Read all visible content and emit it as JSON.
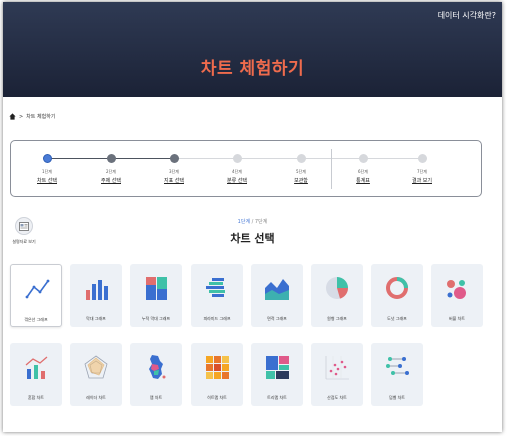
{
  "header": {
    "link_label": "데이터 시각화란?",
    "title": "차트 체험하기"
  },
  "breadcrumb": {
    "current": "차트 체험하기"
  },
  "stepper": {
    "steps": [
      {
        "num": "1단계",
        "label": "차트 선택",
        "state": "active"
      },
      {
        "num": "2단계",
        "label": "주제 선택",
        "state": "done"
      },
      {
        "num": "3단계",
        "label": "지표 선택",
        "state": "done"
      },
      {
        "num": "4단계",
        "label": "분류 선택",
        "state": "todo"
      },
      {
        "num": "5단계",
        "label": "보관함",
        "state": "todo"
      },
      {
        "num": "6단계",
        "label": "통계표",
        "state": "todo"
      },
      {
        "num": "7단계",
        "label": "결과 보기",
        "state": "todo"
      }
    ]
  },
  "guide": {
    "label": "설명자료 보기"
  },
  "page_indicator": {
    "current": "1단계",
    "total": " / 7단계"
  },
  "section_title": "차트 선택",
  "charts": [
    {
      "label": "꺾은선 그래프",
      "icon": "line-chart-icon",
      "selected": true
    },
    {
      "label": "막대 그래프",
      "icon": "bar-chart-icon"
    },
    {
      "label": "누적 막대 그래프",
      "icon": "stacked-bar-chart-icon"
    },
    {
      "label": "피라미드 그래프",
      "icon": "pyramid-chart-icon"
    },
    {
      "label": "면적 그래프",
      "icon": "area-chart-icon"
    },
    {
      "label": "원형 그래프",
      "icon": "pie-chart-icon"
    },
    {
      "label": "도넛 그래프",
      "icon": "donut-chart-icon"
    },
    {
      "label": "버블 차트",
      "icon": "bubble-chart-icon"
    },
    {
      "label": "혼합 차트",
      "icon": "mixed-chart-icon"
    },
    {
      "label": "레이더 차트",
      "icon": "radar-chart-icon"
    },
    {
      "label": "맵 차트",
      "icon": "map-chart-icon"
    },
    {
      "label": "히트맵 차트",
      "icon": "heatmap-chart-icon"
    },
    {
      "label": "트리맵 차트",
      "icon": "treemap-chart-icon"
    },
    {
      "label": "산점도 차트",
      "icon": "scatter-chart-icon"
    },
    {
      "label": "덤벨 차트",
      "icon": "dumbbell-chart-icon"
    }
  ],
  "colors": {
    "header_bg": "#1b2236",
    "title_accent": "#ef6b4d",
    "active_step": "#4a7bd6",
    "card_bg": "#edf1f6"
  }
}
